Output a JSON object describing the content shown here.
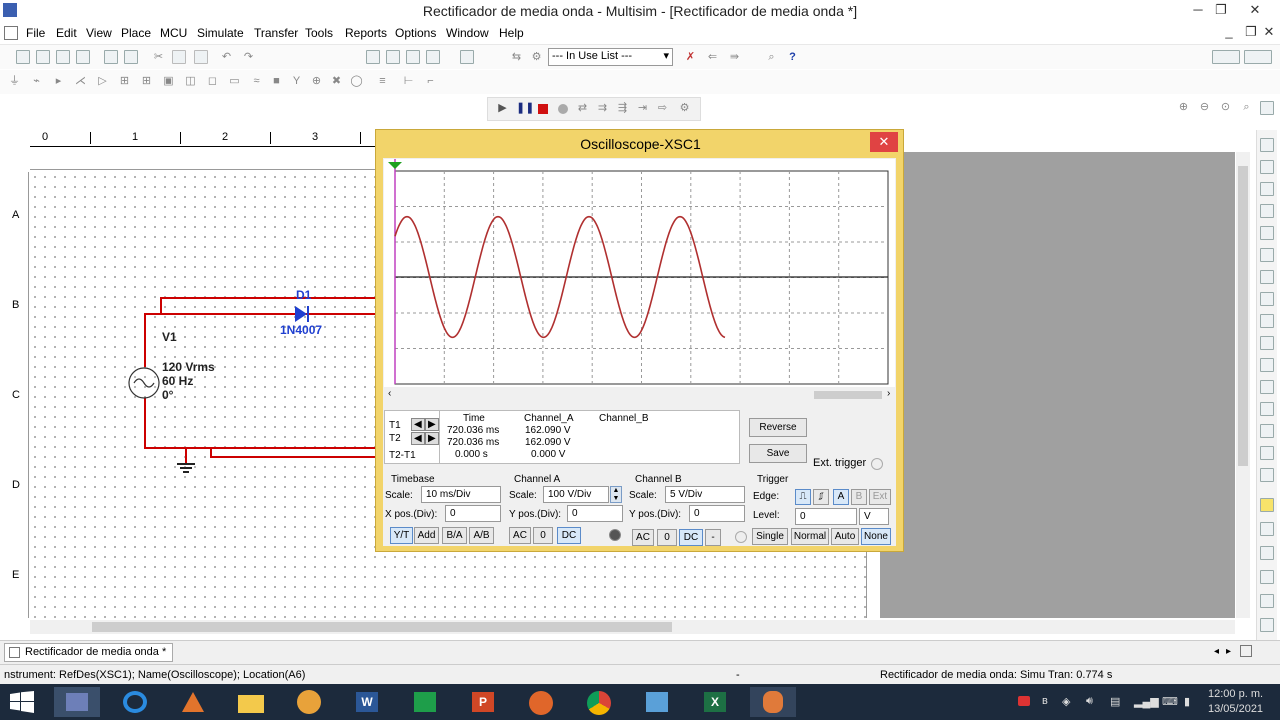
{
  "window": {
    "title": "Rectificador de media onda - Multisim - [Rectificador de media onda *]"
  },
  "menu": [
    "File",
    "Edit",
    "View",
    "Place",
    "MCU",
    "Simulate",
    "Transfer",
    "Tools",
    "Reports",
    "Options",
    "Window",
    "Help"
  ],
  "toolbar": {
    "in_use_list": "--- In Use List ---"
  },
  "ruler": {
    "top": [
      "0",
      "1",
      "2",
      "3"
    ],
    "left": [
      "A",
      "B",
      "C",
      "D",
      "E"
    ]
  },
  "circuit": {
    "diode_ref": "D1",
    "diode_model": "1N4007",
    "source_ref": "V1",
    "source_voltage": "120 Vrms",
    "source_freq": "60 Hz",
    "source_phase": "0°"
  },
  "oscilloscope": {
    "title": "Oscilloscope-XSC1",
    "close": "✕",
    "readout": {
      "headers": [
        "Time",
        "Channel_A",
        "Channel_B"
      ],
      "rows": [
        {
          "label": "T1",
          "time": "720.036 ms",
          "a": "162.090 V",
          "b": ""
        },
        {
          "label": "T2",
          "time": "720.036 ms",
          "a": "162.090 V",
          "b": ""
        },
        {
          "label": "T2-T1",
          "time": "0.000 s",
          "a": "0.000 V",
          "b": ""
        }
      ]
    },
    "buttons": {
      "reverse": "Reverse",
      "save": "Save"
    },
    "ext_trigger": "Ext. trigger",
    "timebase": {
      "label": "Timebase",
      "scale_label": "Scale:",
      "scale": "10 ms/Div",
      "xpos_label": "X pos.(Div):",
      "xpos": "0",
      "modes": [
        "Y/T",
        "Add",
        "B/A",
        "A/B"
      ]
    },
    "channel_a": {
      "label": "Channel A",
      "scale_label": "Scale:",
      "scale": "100  V/Div",
      "ypos_label": "Y pos.(Div):",
      "ypos": "0",
      "coupling": [
        "AC",
        "0",
        "DC"
      ]
    },
    "channel_b": {
      "label": "Channel B",
      "scale_label": "Scale:",
      "scale": "5  V/Div",
      "ypos_label": "Y pos.(Div):",
      "ypos": "0",
      "coupling": [
        "AC",
        "0",
        "DC",
        "-"
      ]
    },
    "trigger": {
      "label": "Trigger",
      "edge_label": "Edge:",
      "level_label": "Level:",
      "level": "0",
      "level_unit": "V",
      "sources": [
        "A",
        "B",
        "Ext"
      ],
      "modes": [
        "Single",
        "Normal",
        "Auto",
        "None"
      ]
    },
    "waveform": {
      "channel_a_scale_v_per_div": 100,
      "timebase_ms_per_div": 10,
      "amplitude_v": 170,
      "frequency_hz": 60,
      "cycles_shown": 3.5
    }
  },
  "tabs": {
    "doc": "Rectificador de media onda *"
  },
  "status": {
    "left": "nstrument: RefDes(XSC1); Name(Oscilloscope); Location(A6)",
    "mid": "-",
    "right": "Rectificador de media onda: Simu  Tran: 0.774 s"
  },
  "clock": {
    "time": "12:00 p. m.",
    "date": "13/05/2021"
  },
  "colors": {
    "wire": "#cc0000",
    "diode": "#1f3fd0",
    "trace": "#b03030",
    "osc_frame": "#f2d46a",
    "close": "#e04343"
  }
}
